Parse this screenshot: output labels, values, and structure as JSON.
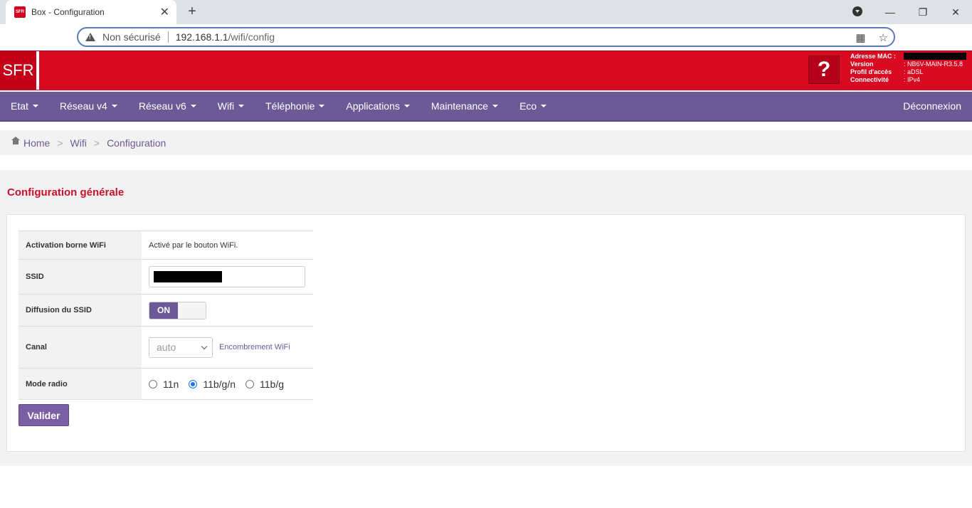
{
  "browser": {
    "tab_title": "Box - Configuration",
    "tab_close": "✕",
    "new_tab": "+",
    "insecure_label": "Non sécurisé",
    "url_host": "192.168.1.1",
    "url_path": "/wifi/config",
    "window_controls": {
      "minimize": "—",
      "maximize": "❐",
      "close": "✕"
    }
  },
  "header": {
    "logo": "SFR",
    "help": "?",
    "info": [
      {
        "key": "Adresse MAC :",
        "value": ""
      },
      {
        "key": "Version",
        "value": ": NB6V-MAIN-R3.5.8"
      },
      {
        "key": "Profil d'accès",
        "value": ": aDSL"
      },
      {
        "key": "Connectivité",
        "value": ": IPv4"
      }
    ]
  },
  "nav": {
    "items": [
      "Etat",
      "Réseau v4",
      "Réseau v6",
      "Wifi",
      "Téléphonie",
      "Applications",
      "Maintenance",
      "Eco"
    ],
    "logout": "Déconnexion"
  },
  "breadcrumb": [
    "Home",
    "Wifi",
    "Configuration"
  ],
  "breadcrumb_sep": ">",
  "section": {
    "title": "Configuration générale",
    "rows": {
      "activation": {
        "label": "Activation borne WiFi",
        "value": "Activé par le bouton WiFi."
      },
      "ssid": {
        "label": "SSID",
        "value": ""
      },
      "broadcast": {
        "label": "Diffusion du SSID",
        "toggle": "ON"
      },
      "channel": {
        "label": "Canal",
        "selected": "auto",
        "link": "Encombrement WiFi"
      },
      "radio_mode": {
        "label": "Mode radio",
        "options": [
          "11n",
          "11b/g/n",
          "11b/g"
        ],
        "selected": "11b/g/n"
      }
    },
    "submit": "Valider"
  },
  "colors": {
    "sfr_red": "#d70a21",
    "nav_purple": "#6c5a97",
    "title_red": "#c8102e"
  }
}
